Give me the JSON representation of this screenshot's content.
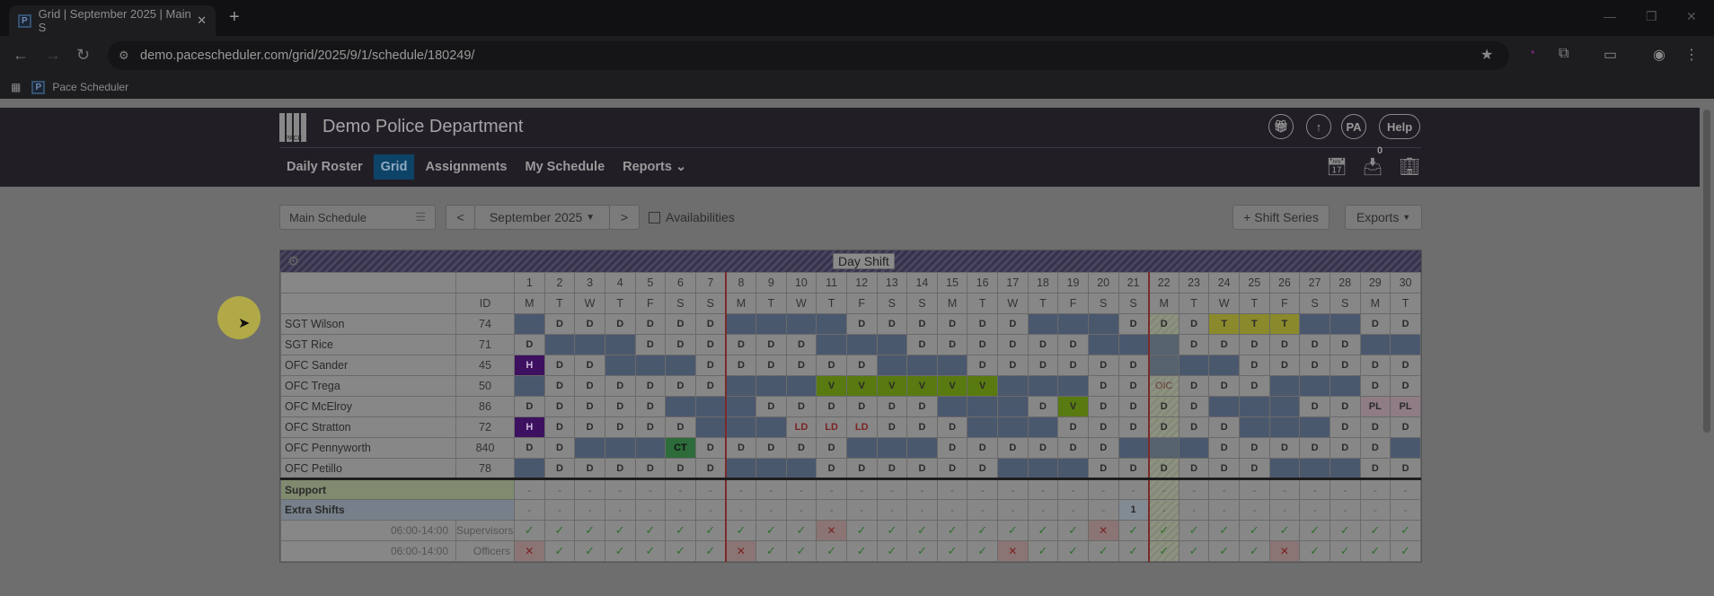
{
  "browser": {
    "tab_title": "Grid | September 2025 | Main S",
    "url": "demo.pacescheduler.com/grid/2025/9/1/schedule/180249/",
    "bookmark": "Pace Scheduler",
    "favicon": "P"
  },
  "app": {
    "department": "Demo Police Department",
    "logo_text": "PACE",
    "menu": [
      "Daily Roster",
      "Grid",
      "Assignments",
      "My Schedule",
      "Reports"
    ],
    "header_buttons": {
      "user": "PA",
      "help": "Help"
    },
    "inbox_count": "0"
  },
  "toolbar": {
    "schedule": "Main Schedule",
    "prev": "<",
    "month": "September 2025",
    "next": ">",
    "availabilities": "Availabilities",
    "shift_series": "+ Shift Series",
    "exports": "Exports"
  },
  "grid": {
    "title": "Day Shift",
    "id_header": "ID",
    "highlight_day": 22,
    "days": [
      "1",
      "2",
      "3",
      "4",
      "5",
      "6",
      "7",
      "8",
      "9",
      "10",
      "11",
      "12",
      "13",
      "14",
      "15",
      "16",
      "17",
      "18",
      "19",
      "20",
      "21",
      "22",
      "23",
      "24",
      "25",
      "26",
      "27",
      "28",
      "29",
      "30"
    ],
    "weekdays": [
      "M",
      "T",
      "W",
      "T",
      "F",
      "S",
      "S",
      "M",
      "T",
      "W",
      "T",
      "F",
      "S",
      "S",
      "M",
      "T",
      "W",
      "T",
      "F",
      "S",
      "S",
      "M",
      "T",
      "W",
      "T",
      "F",
      "S",
      "S",
      "M",
      "T"
    ],
    "employees": [
      {
        "name": "SGT Wilson",
        "id": "74",
        "cells": [
          "",
          "D",
          "D",
          "D",
          "D",
          "D",
          "D",
          "",
          "",
          "",
          "",
          "D",
          "D",
          "D",
          "D",
          "D",
          "D",
          "",
          "",
          "",
          "D",
          "D",
          "D",
          "T",
          "T",
          "T",
          "",
          "",
          "D",
          "D"
        ]
      },
      {
        "name": "SGT Rice",
        "id": "71",
        "cells": [
          "D",
          "",
          "",
          "",
          "D",
          "D",
          "D",
          "D",
          "D",
          "D",
          "",
          "",
          "",
          "D",
          "D",
          "D",
          "D",
          "D",
          "D",
          "",
          "",
          "",
          "D",
          "D",
          "D",
          "D",
          "D",
          "D",
          "",
          ""
        ]
      },
      {
        "name": "OFC Sander",
        "id": "45",
        "cells": [
          "H",
          "D",
          "D",
          "",
          "",
          "",
          "D",
          "D",
          "D",
          "D",
          "D",
          "D",
          "",
          "",
          "",
          "D",
          "D",
          "D",
          "D",
          "D",
          "D",
          "",
          "",
          "",
          "D",
          "D",
          "D",
          "D",
          "D",
          "D"
        ]
      },
      {
        "name": "OFC Trega",
        "id": "50",
        "cells": [
          "",
          "D",
          "D",
          "D",
          "D",
          "D",
          "D",
          "",
          "",
          "",
          "V",
          "V",
          "V",
          "V",
          "V",
          "V",
          "",
          "",
          "",
          "D",
          "D",
          "OIC",
          "D",
          "D",
          "D",
          "",
          "",
          "",
          "D",
          "D"
        ]
      },
      {
        "name": "OFC McElroy",
        "id": "86",
        "cells": [
          "D",
          "D",
          "D",
          "D",
          "D",
          "",
          "",
          "",
          "D",
          "D",
          "D",
          "D",
          "D",
          "D",
          "",
          "",
          "",
          "D",
          "V",
          "D",
          "D",
          "D",
          "D",
          "",
          "",
          "",
          "D",
          "D",
          "PL",
          "PL"
        ]
      },
      {
        "name": "OFC Stratton",
        "id": "72",
        "cells": [
          "H",
          "D",
          "D",
          "D",
          "D",
          "D",
          "",
          "",
          "",
          "LD",
          "LD",
          "LD",
          "D",
          "D",
          "D",
          "",
          "",
          "",
          "D",
          "D",
          "D",
          "D",
          "D",
          "D",
          "",
          "",
          "",
          "D",
          "D",
          "D"
        ]
      },
      {
        "name": "OFC Pennyworth",
        "id": "840",
        "cells": [
          "D",
          "D",
          "",
          "",
          "",
          "CT",
          "D",
          "D",
          "D",
          "D",
          "D",
          "",
          "",
          "",
          "D",
          "D",
          "D",
          "D",
          "D",
          "D",
          "",
          "",
          "",
          "D",
          "D",
          "D",
          "D",
          "D",
          "D",
          ""
        ]
      },
      {
        "name": "OFC Petillo",
        "id": "78",
        "cells": [
          "",
          "D",
          "D",
          "D",
          "D",
          "D",
          "D",
          "",
          "",
          "",
          "D",
          "D",
          "D",
          "D",
          "D",
          "D",
          "",
          "",
          "",
          "D",
          "D",
          "D",
          "D",
          "D",
          "D",
          "",
          "",
          "",
          "D",
          "D"
        ]
      }
    ],
    "support": {
      "label": "Support",
      "cells": [
        "-",
        "-",
        "-",
        "-",
        "-",
        "-",
        "-",
        "-",
        "-",
        "-",
        "-",
        "-",
        "-",
        "-",
        "-",
        "-",
        "-",
        "-",
        "-",
        "-",
        "-",
        "-",
        "-",
        "-",
        "-",
        "-",
        "-",
        "-",
        "-",
        "-"
      ]
    },
    "extra": {
      "label": "Extra Shifts",
      "cells": [
        "-",
        "-",
        "-",
        "-",
        "-",
        "-",
        "-",
        "-",
        "-",
        "-",
        "-",
        "-",
        "-",
        "-",
        "-",
        "-",
        "-",
        "-",
        "-",
        "-",
        "1",
        "-",
        "-",
        "-",
        "-",
        "-",
        "-",
        "-",
        "-",
        "-"
      ]
    },
    "coverage": [
      {
        "time": "06:00-14:00",
        "role": "Supervisors",
        "cells": [
          "ok",
          "ok",
          "ok",
          "ok",
          "ok",
          "ok",
          "ok",
          "ok",
          "ok",
          "ok",
          "x",
          "ok",
          "ok",
          "ok",
          "ok",
          "ok",
          "ok",
          "ok",
          "ok",
          "x",
          "ok",
          "ok",
          "ok",
          "ok",
          "ok",
          "ok",
          "ok",
          "ok",
          "ok",
          "ok"
        ]
      },
      {
        "time": "06:00-14:00",
        "role": "Officers",
        "cells": [
          "x",
          "ok",
          "ok",
          "ok",
          "ok",
          "ok",
          "ok",
          "x",
          "ok",
          "ok",
          "ok",
          "ok",
          "ok",
          "ok",
          "ok",
          "ok",
          "x",
          "ok",
          "ok",
          "ok",
          "ok",
          "ok",
          "ok",
          "ok",
          "ok",
          "x",
          "ok",
          "ok",
          "ok",
          "ok"
        ]
      }
    ]
  }
}
